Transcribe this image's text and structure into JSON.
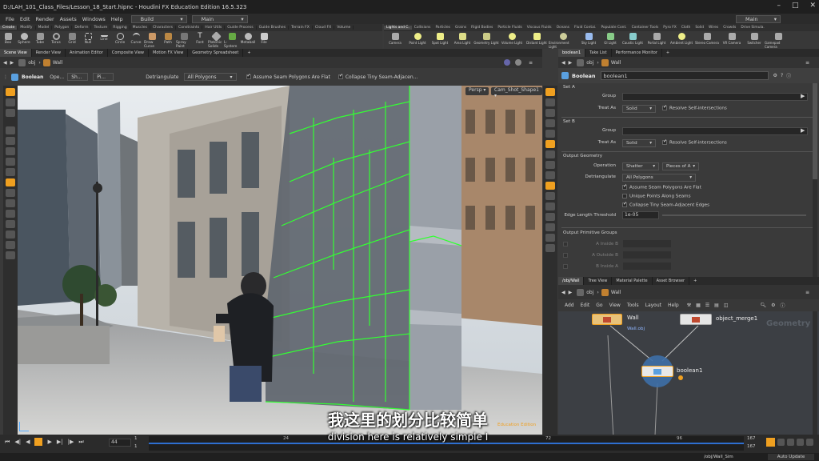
{
  "window": {
    "title": "D:/LAH_101_Class_Files/Lesson_18_Start.hipnc - Houdini FX Education Edition 16.5.323"
  },
  "menu": {
    "items": [
      "File",
      "Edit",
      "Render",
      "Assets",
      "Windows",
      "Help"
    ],
    "desktop": "Build",
    "main": "Main",
    "right_main": "Main"
  },
  "shelf": {
    "tabs_left": [
      "Create",
      "Modify",
      "Model",
      "Polygon",
      "Deform",
      "Texture",
      "Rigging",
      "Muscles",
      "Characters",
      "Constraints",
      "Hair Utils",
      "Guide Process",
      "Guide Brushes",
      "Terrain FX",
      "Cloud FX",
      "Volume"
    ],
    "tools_left": [
      "Box",
      "Sphere",
      "Tube",
      "Torus",
      "Grid",
      "Null",
      "Line",
      "Circle",
      "Curve",
      "Draw Curve",
      "Path",
      "Spray Paint",
      "Font",
      "Platonic Solids",
      "L-System",
      "Metaball",
      "File"
    ],
    "tabs_right": [
      "Lights and C.",
      "Collisions",
      "Particles",
      "Grains",
      "Rigid Bodies",
      "Particle Fluids",
      "Viscous Fluids",
      "Oceans",
      "Fluid Contai.",
      "Populate Cont.",
      "Container Tools",
      "Pyro FX",
      "Cloth",
      "Solid",
      "Wires",
      "Crowds",
      "Drive Simula."
    ],
    "tools_right": [
      "Camera",
      "Point Light",
      "Spot Light",
      "Area Light",
      "Geometry Light",
      "Volume Light",
      "Distant Light",
      "Environment Light",
      "Sky Light",
      "GI Light",
      "Caustic Light",
      "Portal Light",
      "Ambient Light",
      "Stereo Camera",
      "VR Camera",
      "Switcher",
      "Gamepad Camera"
    ]
  },
  "left_pane": {
    "tabs": [
      "Scene View",
      "Render View",
      "Animation Editor",
      "Composite View",
      "Motion FX View",
      "Geometry Spreadsheet"
    ],
    "path": "obj",
    "path_node": "Wall",
    "toolbar": {
      "node_label": "Boolean",
      "op_label": "Ope...",
      "op_value": "Sh...",
      "pie_value": "Pi...",
      "detri_label": "Detriangulate",
      "detri_value": "All Polygons",
      "assume_label": "Assume Seam Polygons Are Flat",
      "collapse_label": "Collapse Tiny Seam-Adjacen..."
    },
    "viewport": {
      "persp": "Persp",
      "camera": "Cam_Shot_Shape1",
      "watermark": "Education Edition"
    }
  },
  "parm_pane": {
    "tabs": [
      "boolean1",
      "Take List",
      "Performance Monitor"
    ],
    "path": "obj",
    "path_node": "Wall",
    "node_type": "Boolean",
    "node_name": "boolean1",
    "set_a": {
      "title": "Set A",
      "group_label": "Group",
      "treat_label": "Treat As",
      "treat_value": "Solid",
      "resolve_label": "Resolve Self-intersections"
    },
    "set_b": {
      "title": "Set B",
      "group_label": "Group",
      "treat_label": "Treat As",
      "treat_value": "Solid",
      "resolve_label": "Resolve Self-intersections"
    },
    "output_geo": {
      "title": "Output Geometry",
      "operation_label": "Operation",
      "operation_value": "Shatter",
      "pieces_value": "Pieces of A",
      "detri_label": "Detriangulate",
      "detri_value": "All Polygons",
      "assume_label": "Assume Seam Polygons Are Flat",
      "unique_label": "Unique Points Along Seams",
      "collapse_label": "Collapse Tiny Seam-Adjacent Edges",
      "edge_label": "Edge Length Threshold",
      "edge_value": "1e-05"
    },
    "output_groups": {
      "title": "Output Primitive Groups",
      "a_inside_b": "A Inside B",
      "a_outside_b": "A Outside B",
      "b_inside_a": "B Inside A"
    }
  },
  "network": {
    "tabs": [
      "/obj/Wall",
      "Tree View",
      "Material Palette",
      "Asset Browser"
    ],
    "path": "obj",
    "path_node": "Wall",
    "menu": [
      "Add",
      "Edit",
      "Go",
      "View",
      "Tools",
      "Layout",
      "Help"
    ],
    "context_label": "Geometry",
    "nodes": {
      "wall": "Wall",
      "wall_sub": "Wall.obj",
      "merge": "object_merge1",
      "boolean": "boolean1"
    }
  },
  "timeline": {
    "frame": "44",
    "start": "1",
    "start2": "1",
    "ticks": [
      "24",
      "72",
      "96"
    ],
    "end": "167",
    "end2": "167"
  },
  "status": {
    "path": "/obj/Wall_Sim",
    "update": "Auto Update"
  },
  "subtitles": {
    "zh": "我这里的划分比较简单",
    "en": "division here is relatively simple I"
  },
  "colors": {
    "accent": "#f0a020",
    "node_wire": "#bfbfbf",
    "boolean_node": "#5aa0e0",
    "wireframe": "#33ff33"
  }
}
